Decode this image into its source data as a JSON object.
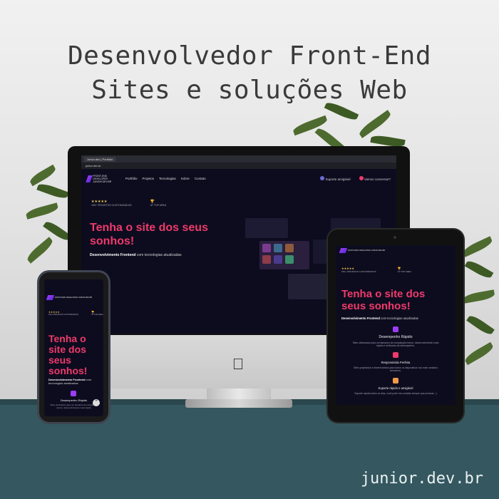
{
  "headline": {
    "line1": "Desenvolvedor Front-End",
    "line2": "Sites e soluções Web"
  },
  "footer_url": "junior.dev.br",
  "brand": {
    "logo_text": "FRONT-END DEVELOPER JUNIOR.DEV.BR",
    "accent": "#ef3a6a",
    "purple": "#9b3cf6",
    "background": "#0d0c1f"
  },
  "desktop": {
    "browser_tab": "Junior.dev | Portfólio",
    "url": "junior.dev.br",
    "nav": [
      "Portfólio",
      "Projetos",
      "Tecnologias",
      "Sobre",
      "Contato"
    ],
    "support_label": "Suporte amigável",
    "contact_label": "Vamos conversar?",
    "stat1_label": "150+ PROJETOS CUSTOMIZADOS",
    "stat2_label": "AT TOP AREA",
    "stars": "★★★★★",
    "trophy": "🏆",
    "hero_title": "Tenha o site dos seus sonhos!",
    "hero_sub_bold": "Desenvolvimento Frontend",
    "hero_sub_rest": " com tecnologias atualizadas"
  },
  "tablet": {
    "hero_title": "Tenha o site dos seus sonhos!",
    "hero_sub_bold": "Desenvolvimento Frontend",
    "hero_sub_rest": " com tecnologias atualizadas",
    "features": [
      {
        "title": "Desempenho Rápido",
        "text": "Sites otimizados para um tamanho de compilação menor, desenvolvimento mais rápido e melhorias de desempenho.",
        "color": "#9b3cf6"
      },
      {
        "title": "Responsivida Perfeita",
        "text": "Sites projetados e desenvolvidos para todos os dispositivos nos mais variados tamanhos.",
        "color": "#ef3a6a"
      },
      {
        "title": "Suporte rápido e amigável",
        "text": "Suporte rápido todos os dias, você pode me contatar sempre que precisar :-)",
        "color": "#f2994a"
      }
    ]
  },
  "phone": {
    "hero_title": "Tenha o site dos seus sonhos!",
    "hero_sub_bold": "Desenvolvimento Frontend",
    "hero_sub_rest": " com tecnologias atualizadas",
    "feature_title": "Desempenho Rápido",
    "feature_text": "Sites otimizados para um tamanho de compilação menor, desenvolvimento mais rápido",
    "scroll_icon": "chevron-up-icon"
  }
}
